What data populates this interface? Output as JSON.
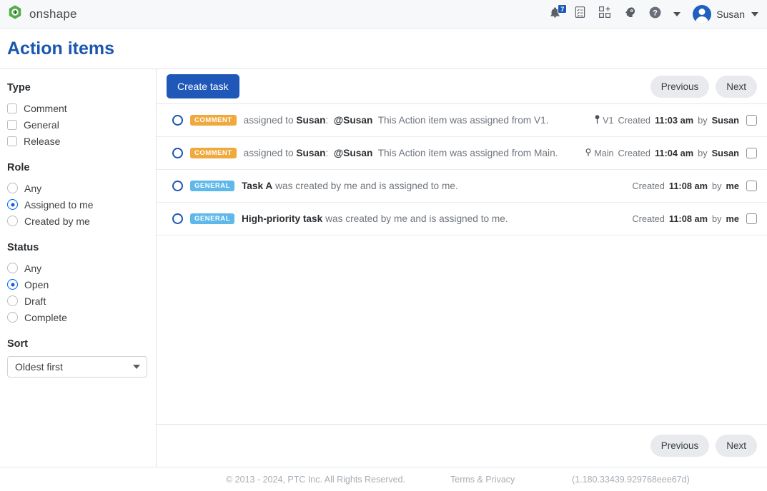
{
  "topbar": {
    "brand_name": "onshape",
    "logo_icon": "onshape-logo-icon",
    "notifications_icon": "bell-icon",
    "notifications_count": "7",
    "tasks_icon": "clipboard-tasks-icon",
    "apps_icon": "apps-grid-plus-icon",
    "learning_icon": "learning-center-icon",
    "help_icon": "help-circle-icon",
    "help_caret_icon": "chevron-down-icon",
    "avatar_icon": "user-avatar-icon",
    "user_name": "Susan",
    "user_caret_icon": "chevron-down-icon"
  },
  "page": {
    "title": "Action items"
  },
  "sidebar": {
    "groups": [
      {
        "title": "Type",
        "control": "checkbox",
        "options": [
          {
            "label": "Comment",
            "checked": false
          },
          {
            "label": "General",
            "checked": false
          },
          {
            "label": "Release",
            "checked": false
          }
        ]
      },
      {
        "title": "Role",
        "control": "radio",
        "options": [
          {
            "label": "Any",
            "checked": false
          },
          {
            "label": "Assigned to me",
            "checked": true
          },
          {
            "label": "Created by me",
            "checked": false
          }
        ]
      },
      {
        "title": "Status",
        "control": "radio",
        "options": [
          {
            "label": "Any",
            "checked": false
          },
          {
            "label": "Open",
            "checked": true
          },
          {
            "label": "Draft",
            "checked": false
          },
          {
            "label": "Complete",
            "checked": false
          }
        ]
      }
    ],
    "sort": {
      "title": "Sort",
      "selected": "Oldest first",
      "arrow_icon": "chevron-down-icon"
    }
  },
  "toolbar": {
    "create_task_label": "Create task",
    "previous_label": "Previous",
    "next_label": "Next"
  },
  "list": {
    "rows": [
      {
        "status_icon": "open-circle-icon",
        "badge": "COMMENT",
        "badge_type": "comment",
        "text_prefix": "assigned to ",
        "text_assignee": "Susan",
        "text_colon": ":",
        "text_mention": "@Susan",
        "text_body": "This Action item was assigned from V1.",
        "ref_icon": "version-pin-icon",
        "ref_label": "V1",
        "created_prefix": "Created",
        "created_time": "11:03 am",
        "created_by_prefix": "by",
        "created_by": "Susan",
        "checkbox_icon": "task-checkbox"
      },
      {
        "status_icon": "open-circle-icon",
        "badge": "COMMENT",
        "badge_type": "comment",
        "text_prefix": "assigned to ",
        "text_assignee": "Susan",
        "text_colon": ":",
        "text_mention": "@Susan",
        "text_body": "This Action item was assigned from Main.",
        "ref_icon": "workspace-branch-icon",
        "ref_label": "Main",
        "created_prefix": "Created",
        "created_time": "11:04 am",
        "created_by_prefix": "by",
        "created_by": "Susan",
        "checkbox_icon": "task-checkbox"
      },
      {
        "status_icon": "open-circle-icon",
        "badge": "GENERAL",
        "badge_type": "general",
        "text_prefix": "",
        "text_assignee": "Task A",
        "text_colon": "",
        "text_mention": "",
        "text_body": "was created by me and is assigned to me.",
        "ref_icon": "",
        "ref_label": "",
        "created_prefix": "Created",
        "created_time": "11:08 am",
        "created_by_prefix": "by",
        "created_by": "me",
        "checkbox_icon": "task-checkbox"
      },
      {
        "status_icon": "open-circle-icon",
        "badge": "GENERAL",
        "badge_type": "general",
        "text_prefix": "",
        "text_assignee": "High-priority task",
        "text_colon": "",
        "text_mention": "",
        "text_body": "was created by me and is assigned to me.",
        "ref_icon": "",
        "ref_label": "",
        "created_prefix": "Created",
        "created_time": "11:08 am",
        "created_by_prefix": "by",
        "created_by": "me",
        "checkbox_icon": "task-checkbox"
      }
    ]
  },
  "list_footer": {
    "previous_label": "Previous",
    "next_label": "Next"
  },
  "footer": {
    "copyright": "© 2013 - 2024, PTC Inc. All Rights Reserved.",
    "terms": "Terms & Privacy",
    "version": "(1.180.33439.929768eee67d)"
  },
  "colors": {
    "brand_green": "#55ab4a",
    "primary_blue": "#1f58b8",
    "title_blue": "#1a56b0",
    "badge_comment": "#f0a93c",
    "badge_general": "#5fb8ea",
    "radio_selected": "#0a62e0"
  }
}
